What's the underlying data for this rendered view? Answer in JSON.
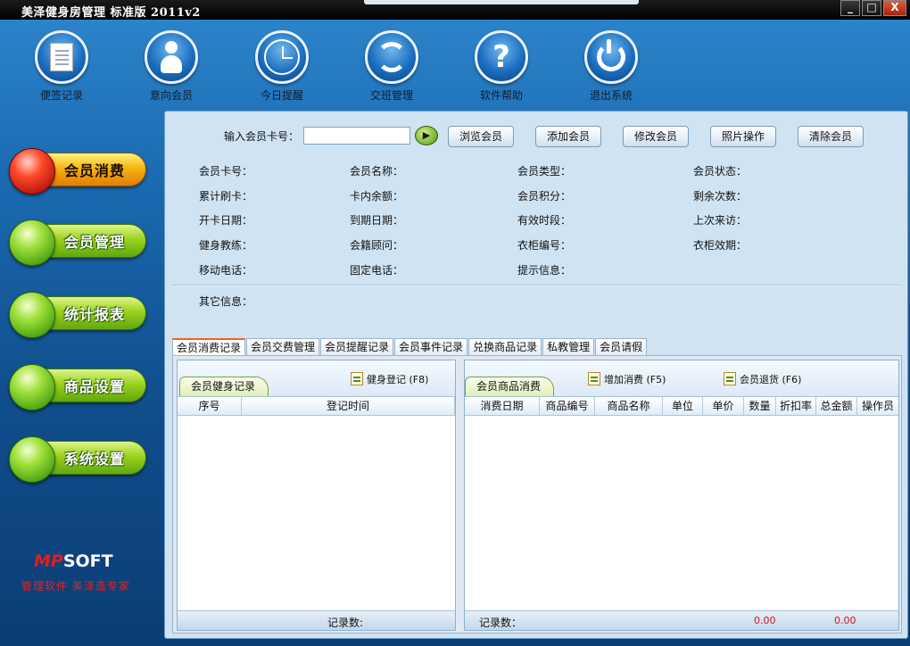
{
  "window": {
    "title": "美泽健身房管理 标准版 2011v2",
    "min_label": "_",
    "max_label": "□",
    "close_label": "X"
  },
  "toolbar": {
    "items": [
      {
        "label": "便签记录",
        "icon": "note-icon"
      },
      {
        "label": "意向会员",
        "icon": "person-icon"
      },
      {
        "label": "今日提醒",
        "icon": "clock-icon"
      },
      {
        "label": "交班管理",
        "icon": "refresh-icon"
      },
      {
        "label": "软件帮助",
        "icon": "help-icon"
      },
      {
        "label": "退出系统",
        "icon": "power-icon"
      }
    ]
  },
  "sidebar": {
    "items": [
      {
        "label": "会员消费",
        "active": true
      },
      {
        "label": "会员管理",
        "active": false
      },
      {
        "label": "统计报表",
        "active": false
      },
      {
        "label": "商品设置",
        "active": false
      },
      {
        "label": "系统设置",
        "active": false
      }
    ],
    "logo_a": "MP",
    "logo_b": "SOFT",
    "slogan": "管理软件  美泽造专家"
  },
  "search": {
    "label": "输入会员卡号：",
    "value": "",
    "go_label": "▶",
    "buttons": [
      "浏览会员",
      "添加会员",
      "修改会员",
      "照片操作",
      "清除会员"
    ]
  },
  "info": {
    "rows": [
      [
        "会员卡号：",
        "会员名称：",
        "会员类型：",
        "会员状态："
      ],
      [
        "累计刷卡：",
        "卡内余额：",
        "会员积分：",
        "剩余次数："
      ],
      [
        "开卡日期：",
        "到期日期：",
        "有效时段：",
        "上次来访："
      ],
      [
        "健身教练：",
        "会籍顾问：",
        "衣柜编号：",
        "衣柜效期："
      ],
      [
        "移动电话：",
        "固定电话：",
        "提示信息：",
        ""
      ]
    ],
    "other_label": "其它信息："
  },
  "tabs": [
    "会员消费记录",
    "会员交费管理",
    "会员提醒记录",
    "会员事件记录",
    "兑换商品记录",
    "私教管理",
    "会员请假"
  ],
  "left_panel": {
    "subtab": "会员健身记录",
    "action": "健身登记 (F8)",
    "columns": [
      "序号",
      "登记时间"
    ],
    "footer": "记录数:"
  },
  "right_panel": {
    "subtab": "会员商品消费",
    "action_add": "增加消费 (F5)",
    "action_return": "会员退货 (F6)",
    "columns": [
      "消费日期",
      "商品编号",
      "商品名称",
      "单位",
      "单价",
      "数量",
      "折扣率",
      "总金额",
      "操作员"
    ],
    "footer": "记录数：",
    "total1": "0.00",
    "total2": "0.00"
  }
}
